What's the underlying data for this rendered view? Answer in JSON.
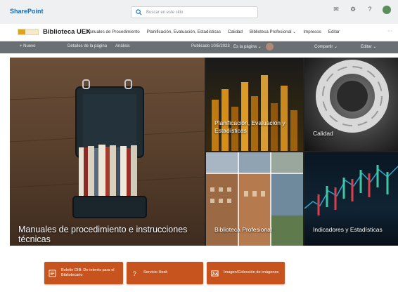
{
  "suitebar": {
    "app_name": "SharePoint",
    "search_placeholder": "Buscar en este sitio",
    "icons": [
      "megaphone-icon",
      "settings-icon",
      "help-icon",
      "avatar"
    ]
  },
  "site": {
    "title": "Biblioteca UEX",
    "nav": [
      {
        "label": "Manuales de Procedimiento"
      },
      {
        "label": "Planificación, Evaluación, Estadísticas"
      },
      {
        "label": "Calidad"
      },
      {
        "label": "Biblioteca Profesional ⌄"
      },
      {
        "label": "Impresos"
      },
      {
        "label": "Editar"
      }
    ],
    "more": "···"
  },
  "commandbar": {
    "new": "+ Nuevo",
    "details": "Detalles de la página",
    "analytics": "Análisis",
    "published": "Publicado 10/5/2023",
    "status": "Es la página ⌄",
    "share": "Compartir ⌄",
    "edit": "Editar ⌄"
  },
  "hero": {
    "tiles": [
      {
        "name": "tile-manuales",
        "label": "Manuales de procedimiento e instrucciones técnicas"
      },
      {
        "name": "tile-planificacion",
        "label": "Planificación, Evaluación y Estadísticas"
      },
      {
        "name": "tile-calidad",
        "label": "Calidad"
      },
      {
        "name": "tile-biblioteca",
        "label": "Biblioteca Profesional"
      },
      {
        "name": "tile-indicadores",
        "label": "Indicadores y Estadísticas"
      }
    ]
  },
  "quicklinks": [
    {
      "label": "Boletín DIB: De interés para el Bibliotecario",
      "icon": "newsletter-icon"
    },
    {
      "label": "Servicio Hesk",
      "icon": "question-icon"
    },
    {
      "label": "Imagen/Colección de imágenes",
      "icon": "image-icon"
    }
  ],
  "colors": {
    "brand_blue": "#0f6cbd",
    "commandbar": "#6a6f74",
    "quicklink_orange": "#c7541f"
  }
}
